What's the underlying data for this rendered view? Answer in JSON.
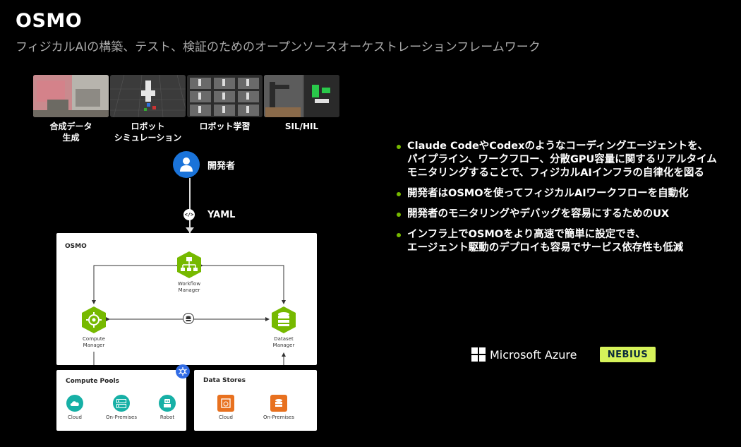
{
  "header": {
    "title": "OSMO",
    "subtitle": "フィジカルAIの構築、テスト、検証のためのオープンソースオーケストレーションフレームワーク"
  },
  "workflow_stages": [
    {
      "label_line1": "合成データ",
      "label_line2": "生成"
    },
    {
      "label_line1": "ロボット",
      "label_line2": "シミュレーション"
    },
    {
      "label_line1": "ロボット学習",
      "label_line2": ""
    },
    {
      "label_line1": "SIL/HIL",
      "label_line2": ""
    }
  ],
  "developer": {
    "label": "開発者",
    "icon": "person-icon"
  },
  "yaml": {
    "label": "YAML",
    "icon": "code-icon"
  },
  "osmo_box": {
    "title": "OSMO",
    "workflow_manager": {
      "line1": "Workflow",
      "line2": "Manager"
    },
    "compute_manager": {
      "line1": "Compute",
      "line2": "Manager"
    },
    "dataset_manager": {
      "line1": "Dataset",
      "line2": "Manager"
    }
  },
  "compute_pools": {
    "title": "Compute Pools",
    "items": [
      "Cloud",
      "On-Premises",
      "Robot"
    ]
  },
  "data_stores": {
    "title": "Data Stores",
    "items": [
      "Cloud",
      "On-Premises"
    ]
  },
  "bullets": [
    {
      "lines": [
        "Claude CodeやCodexのようなコーディングエージェントを、",
        "パイプライン、ワークフロー、分散GPU容量に関するリアルタイム",
        "モニタリングすることで、フィジカルAIインフラの自律化を図る"
      ]
    },
    {
      "lines": [
        "開発者はOSMOを使ってフィジカルAIワークフローを自動化"
      ]
    },
    {
      "lines": [
        "開発者のモニタリングやデバッグを容易にするためのUX"
      ]
    },
    {
      "lines": [
        "インフラ上でOSMOをより高速で簡単に設定でき、",
        "エージェント駆動のデプロイも容易でサービス依存性も低減"
      ]
    }
  ],
  "partners": {
    "azure": "Microsoft Azure",
    "nebius": "NEBIUS"
  },
  "colors": {
    "accent_green": "#76b900",
    "developer_blue": "#1a73d9",
    "teal": "#17b0a6",
    "orange": "#e8711f",
    "nebius_bg": "#d6f35a"
  }
}
